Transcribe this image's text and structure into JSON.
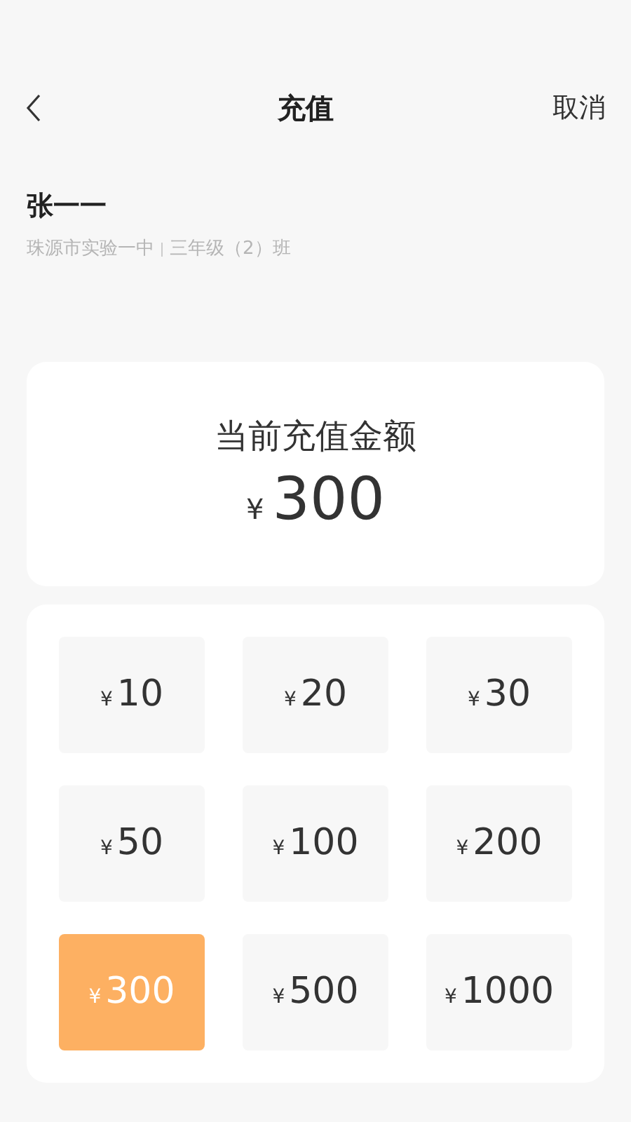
{
  "header": {
    "title": "充值",
    "cancel": "取消"
  },
  "student": {
    "name": "张一一",
    "school": "珠源市实验一中",
    "class": "三年级（2）班"
  },
  "current": {
    "label": "当前充值金额",
    "currency": "¥",
    "amount": "300"
  },
  "options": [
    {
      "currency": "¥",
      "amount": "10",
      "selected": false
    },
    {
      "currency": "¥",
      "amount": "20",
      "selected": false
    },
    {
      "currency": "¥",
      "amount": "30",
      "selected": false
    },
    {
      "currency": "¥",
      "amount": "50",
      "selected": false
    },
    {
      "currency": "¥",
      "amount": "100",
      "selected": false
    },
    {
      "currency": "¥",
      "amount": "200",
      "selected": false
    },
    {
      "currency": "¥",
      "amount": "300",
      "selected": true
    },
    {
      "currency": "¥",
      "amount": "500",
      "selected": false
    },
    {
      "currency": "¥",
      "amount": "1000",
      "selected": false
    }
  ]
}
